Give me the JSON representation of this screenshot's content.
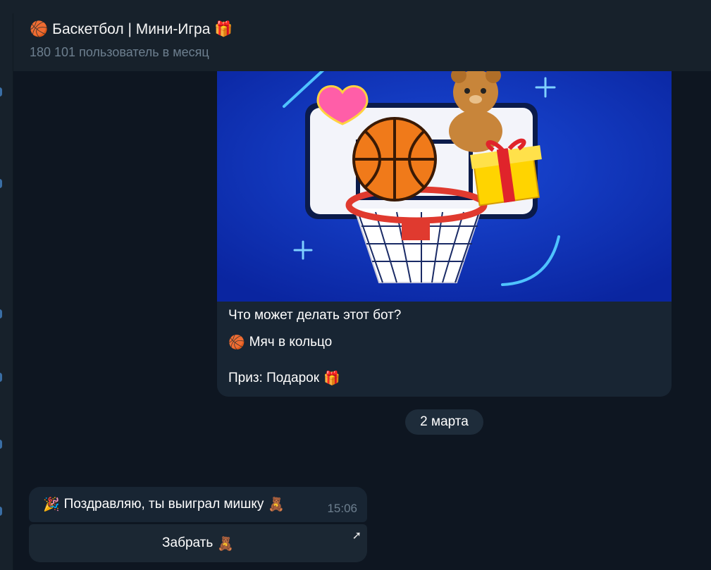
{
  "header": {
    "title_icon": "🏀",
    "title": "Баскетбол | Мини-Игра",
    "title_suffix_icon": "🎁",
    "subtitle": "180 101 пользователь в месяц"
  },
  "bot_card": {
    "question": "Что может делать этот бот?",
    "feature_icon": "🏀",
    "feature": "Мяч в кольцо",
    "prize": "Приз: Подарок",
    "prize_icon": "🎁"
  },
  "date_separator": "2 марта",
  "message": {
    "icon": "🎉",
    "text": "Поздравляю, ты выиграл мишку",
    "text_icon": "🧸",
    "time": "15:06"
  },
  "inline_button": {
    "label": "Забрать",
    "icon": "🧸",
    "arrow": "➚"
  },
  "colors": {
    "background": "#0e1621",
    "panel": "#17212b",
    "bubble": "#182533",
    "muted_text": "#6d7f8f",
    "art_blue": "#0a2ea8"
  }
}
